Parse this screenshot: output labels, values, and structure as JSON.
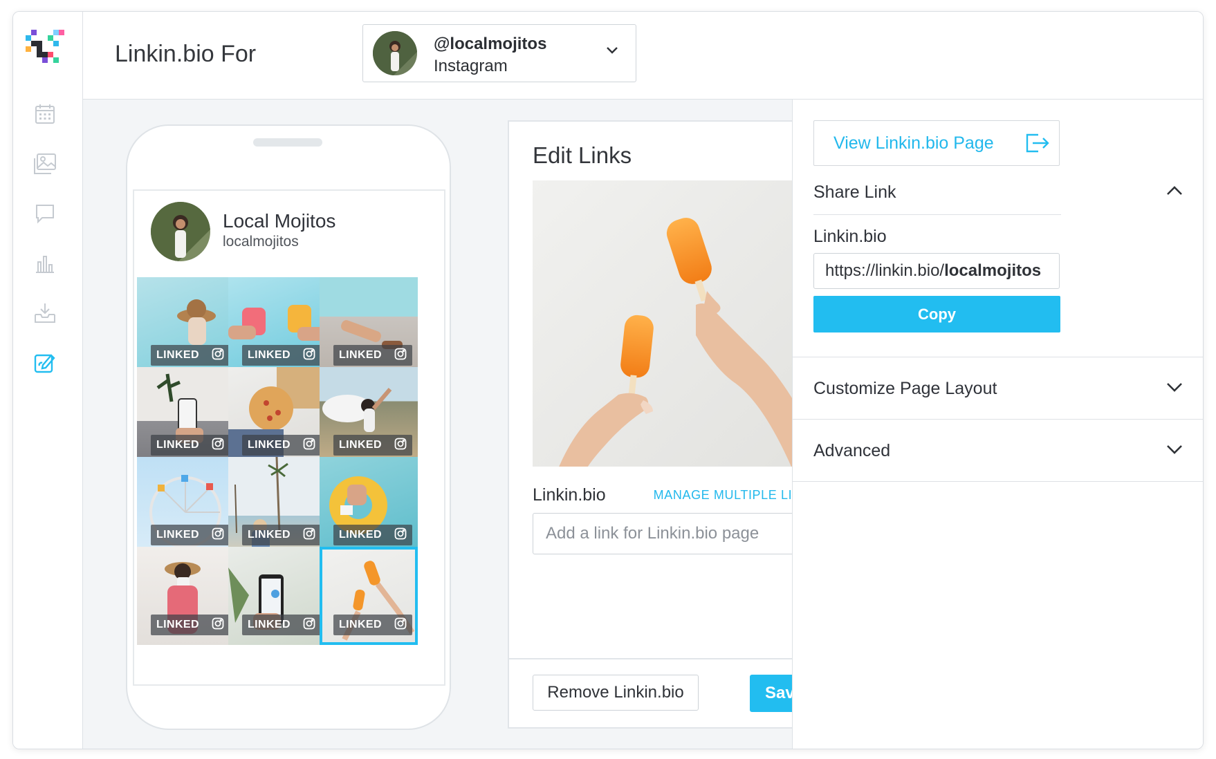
{
  "header": {
    "title": "Linkin.bio For",
    "account": {
      "handle": "@localmojitos",
      "platform": "Instagram"
    }
  },
  "sidebar": {
    "items": [
      {
        "icon": "calendar-icon"
      },
      {
        "icon": "media-icon"
      },
      {
        "icon": "conversations-icon"
      },
      {
        "icon": "analytics-icon"
      },
      {
        "icon": "inbox-icon"
      },
      {
        "icon": "linkin-bio-icon",
        "active": true
      }
    ]
  },
  "profile": {
    "name": "Local Mojitos",
    "handle": "localmojitos"
  },
  "grid": {
    "badge": "LINKED",
    "tiles": [
      {
        "label": "LINKED"
      },
      {
        "label": "LINKED"
      },
      {
        "label": "LINKED"
      },
      {
        "label": "LINKED"
      },
      {
        "label": "LINKED"
      },
      {
        "label": "LINKED"
      },
      {
        "label": "LINKED"
      },
      {
        "label": "LINKED"
      },
      {
        "label": "LINKED"
      },
      {
        "label": "LINKED"
      },
      {
        "label": "LINKED"
      },
      {
        "label": "LINKED",
        "selected": true
      }
    ]
  },
  "edit": {
    "title": "Edit Links",
    "link_label": "Linkin.bio",
    "manage_label": "MANAGE MULTIPLE LINKS",
    "link_placeholder": "Add a link for Linkin.bio page",
    "remove_label": "Remove Linkin.bio",
    "save_label": "Save"
  },
  "right": {
    "view_label": "View Linkin.bio Page",
    "share_label": "Share Link",
    "linkinbio_label": "Linkin.bio",
    "url_prefix": "https://linkin.bio/",
    "url_handle": "localmojitos",
    "copy_label": "Copy",
    "customize_label": "Customize Page Layout",
    "advanced_label": "Advanced"
  },
  "colors": {
    "accent": "#22bdf0",
    "background": "#f3f5f7"
  }
}
